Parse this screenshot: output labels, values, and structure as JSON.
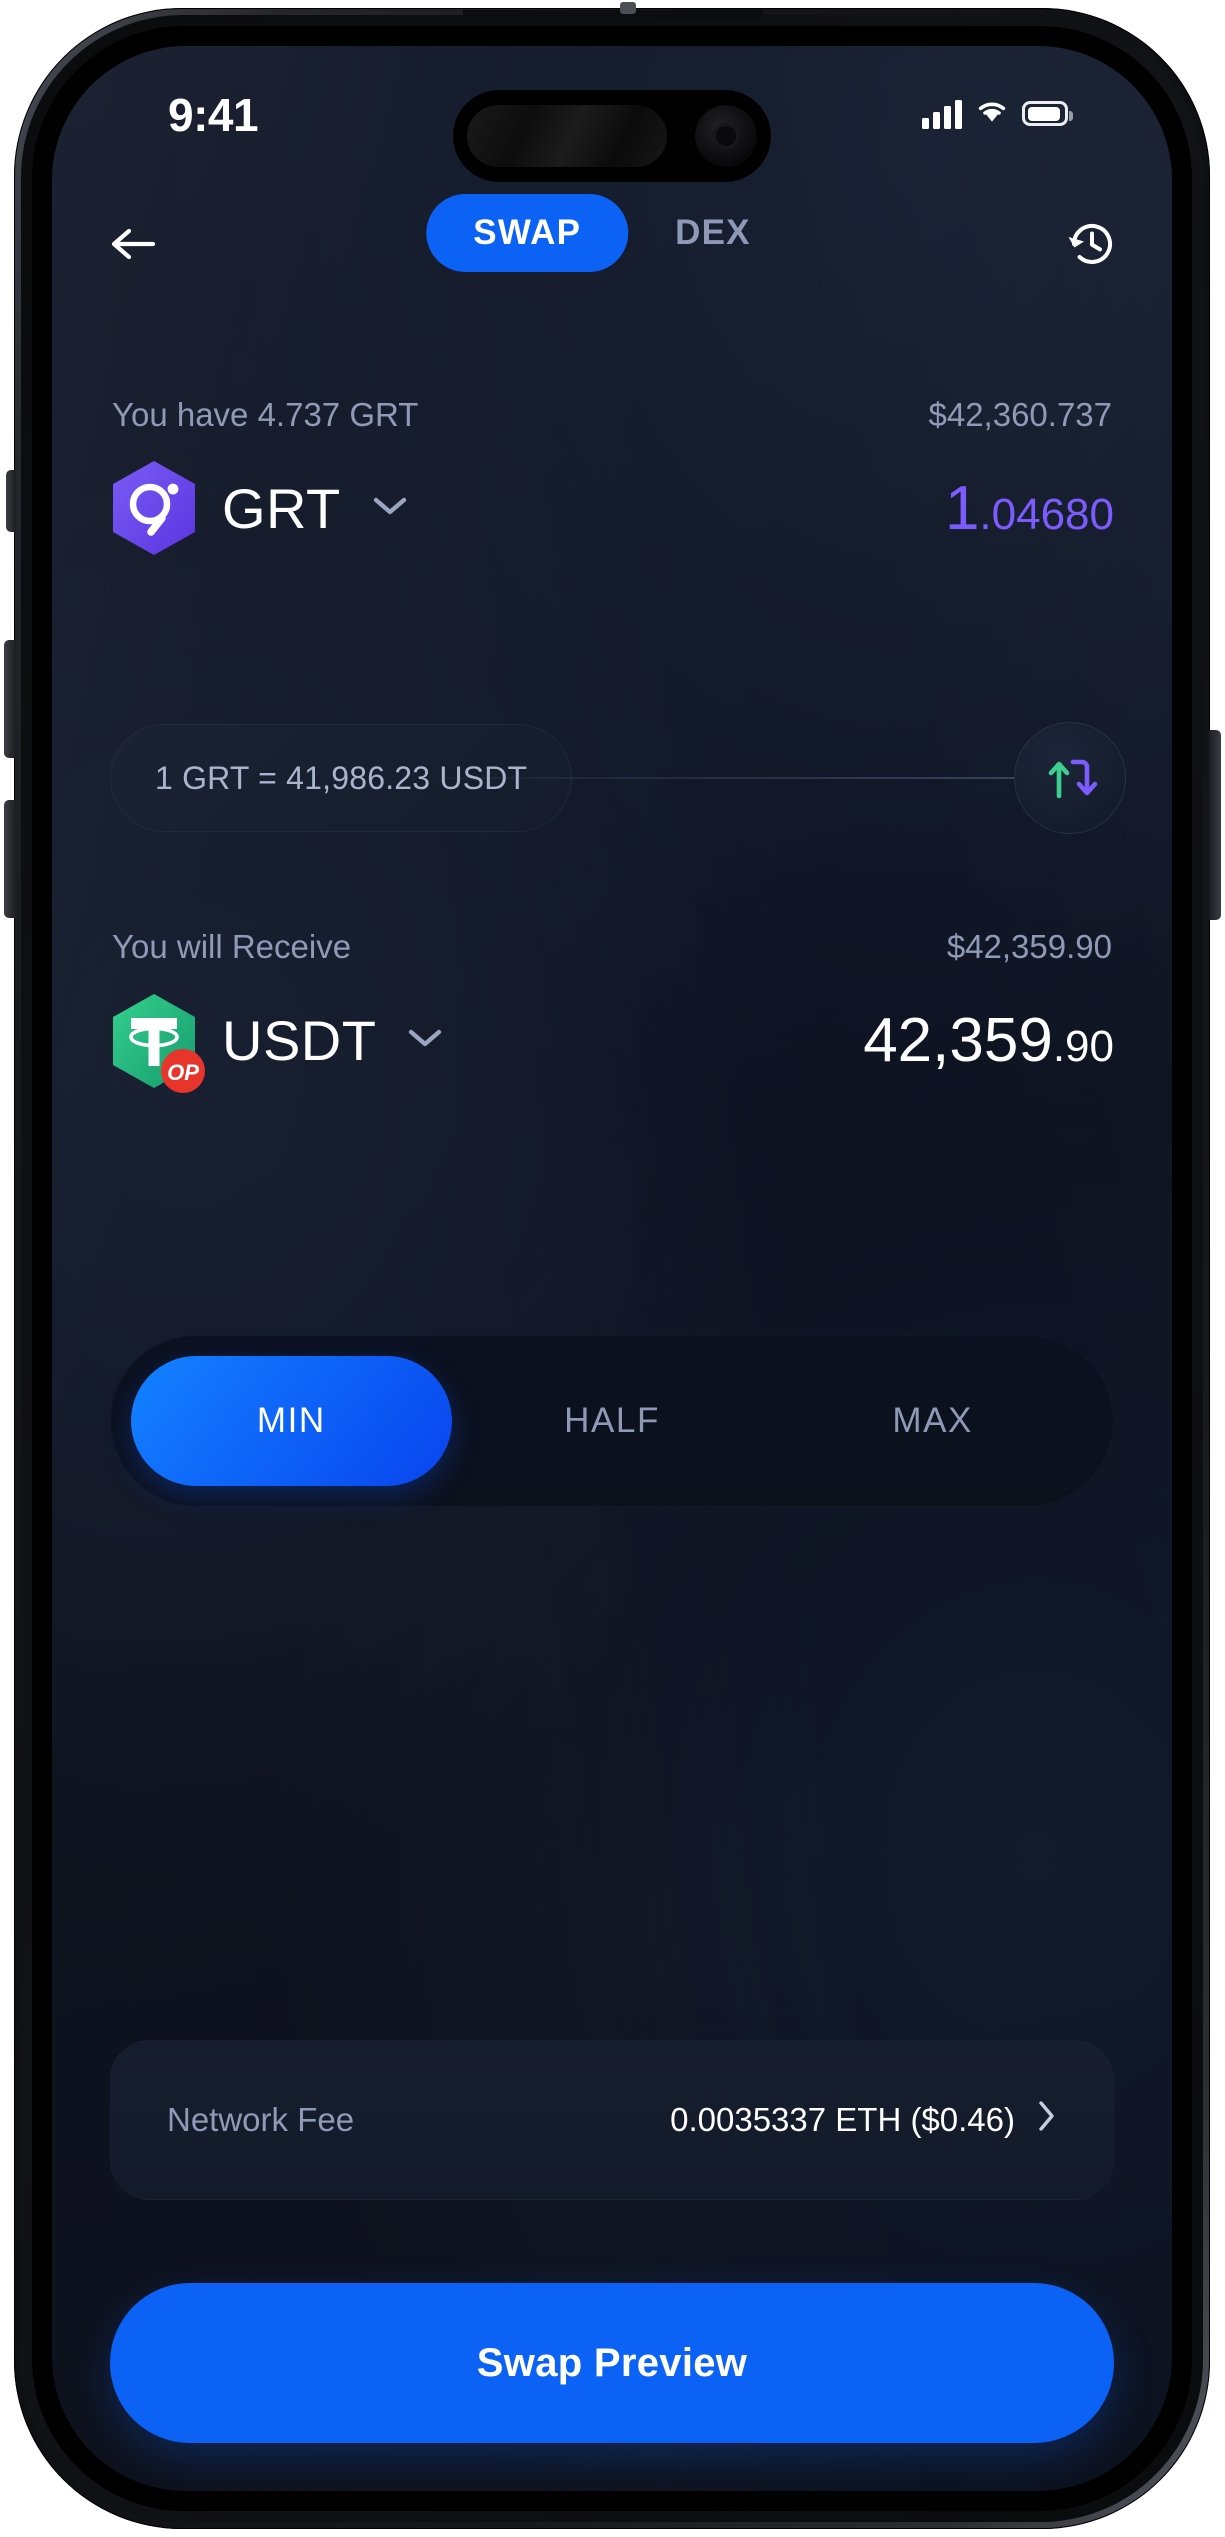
{
  "status_bar": {
    "time": "9:41",
    "cellular_icon": "cellular-signal-icon",
    "wifi_icon": "wifi-icon",
    "battery_icon": "battery-icon"
  },
  "nav": {
    "back_icon": "arrow-left-icon",
    "history_icon": "clock-history-icon",
    "tabs": [
      {
        "label": "SWAP",
        "active": true
      },
      {
        "label": "DEX",
        "active": false
      }
    ]
  },
  "from": {
    "balance_label": "You have 4.737 GRT",
    "fiat_value": "$42,360.737",
    "token_symbol": "GRT",
    "token_icon": "grt-token-icon",
    "chevron_icon": "chevron-down-icon",
    "amount_integer": "1",
    "amount_decimal": ".04680"
  },
  "rate": {
    "text": "1 GRT = 41,986.23 USDT",
    "swap_icon": "swap-direction-icon"
  },
  "to": {
    "receive_label": "You will Receive",
    "fiat_value": "$42,359.90",
    "token_symbol": "USDT",
    "token_icon": "usdt-token-icon",
    "network_badge": "OP",
    "chevron_icon": "chevron-down-icon",
    "amount_integer": "42,359",
    "amount_decimal": ".90"
  },
  "percent_selector": [
    {
      "label": "MIN",
      "active": true
    },
    {
      "label": "HALF",
      "active": false
    },
    {
      "label": "MAX",
      "active": false
    }
  ],
  "network_fee": {
    "label": "Network Fee",
    "value": "0.0035337 ETH ($0.46)",
    "chevron_icon": "chevron-right-icon"
  },
  "cta": {
    "label": "Swap Preview"
  },
  "colors": {
    "accent_blue": "#0c62f5",
    "purple": "#7c5cfc",
    "green": "#3ecf8e",
    "grt_purple": "#6747ed",
    "usdt_green": "#26a17b",
    "op_red": "#e8352c",
    "muted_text": "#8f9ab6",
    "screen_bg": "#0e1322"
  }
}
